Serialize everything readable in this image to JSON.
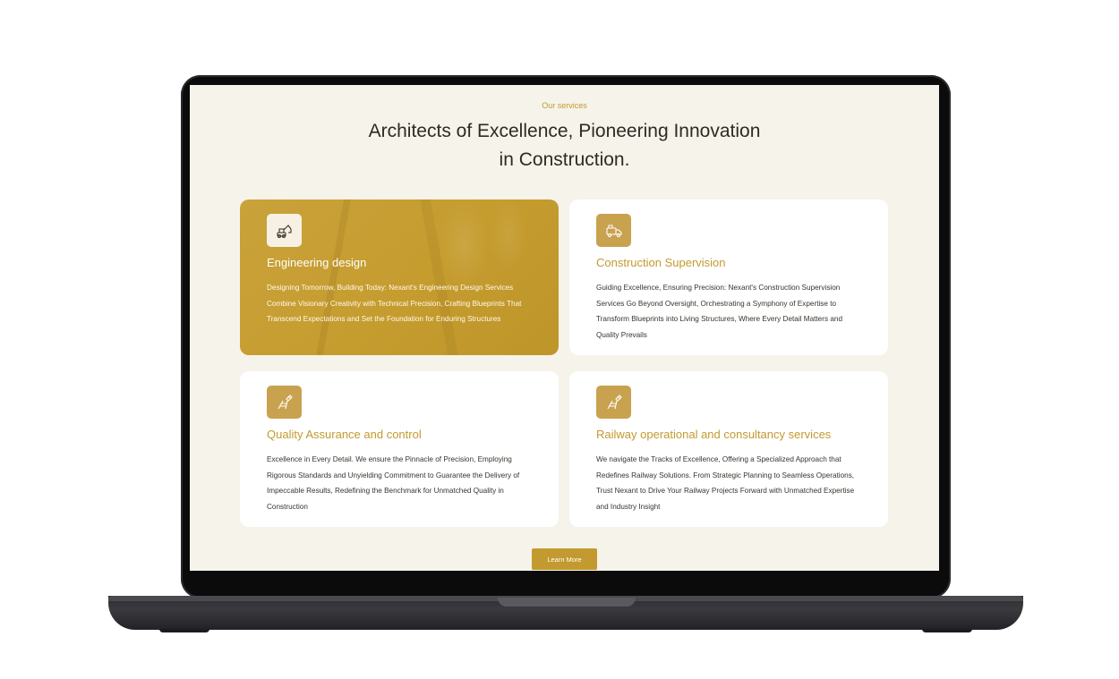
{
  "section": {
    "eyebrow": "Our services",
    "headline_line1": "Architects of Excellence, Pioneering Innovation",
    "headline_line2": "in Construction."
  },
  "cards": [
    {
      "title": "Engineering design",
      "icon": "excavator-icon",
      "description": "Designing Tomorrow, Building Today: Nexant's Engineering Design Services Combine Visionary Creativity with Technical Precision, Crafting Blueprints That Transcend Expectations and Set the Foundation for Enduring Structures"
    },
    {
      "title": "Construction Supervision",
      "icon": "truck-icon",
      "description": "Guiding Excellence, Ensuring Precision: Nexant's Construction Supervision Services Go Beyond Oversight, Orchestrating a Symphony of Expertise to Transform Blueprints into Living Structures, Where Every Detail Matters and Quality Prevails"
    },
    {
      "title": "Quality Assurance and control",
      "icon": "railway-icon",
      "description": "Excellence in Every Detail. We ensure the Pinnacle of Precision, Employing Rigorous Standards and Unyielding Commitment to Guarantee the Delivery of Impeccable Results, Redefining the Benchmark for Unmatched Quality in Construction"
    },
    {
      "title": "Railway operational and consultancy services",
      "icon": "railway-icon",
      "description": "We navigate the Tracks of Excellence, Offering a Specialized Approach that Redefines Railway Solutions. From Strategic Planning to Seamless Operations, Trust Nexant to Drive Your Railway Projects Forward with Unmatched Expertise and Industry Insight"
    }
  ],
  "cta": {
    "label": "Learn More"
  },
  "colors": {
    "accent": "#c39a2f",
    "background": "#f6f3ea",
    "heading": "#2f2a26"
  }
}
